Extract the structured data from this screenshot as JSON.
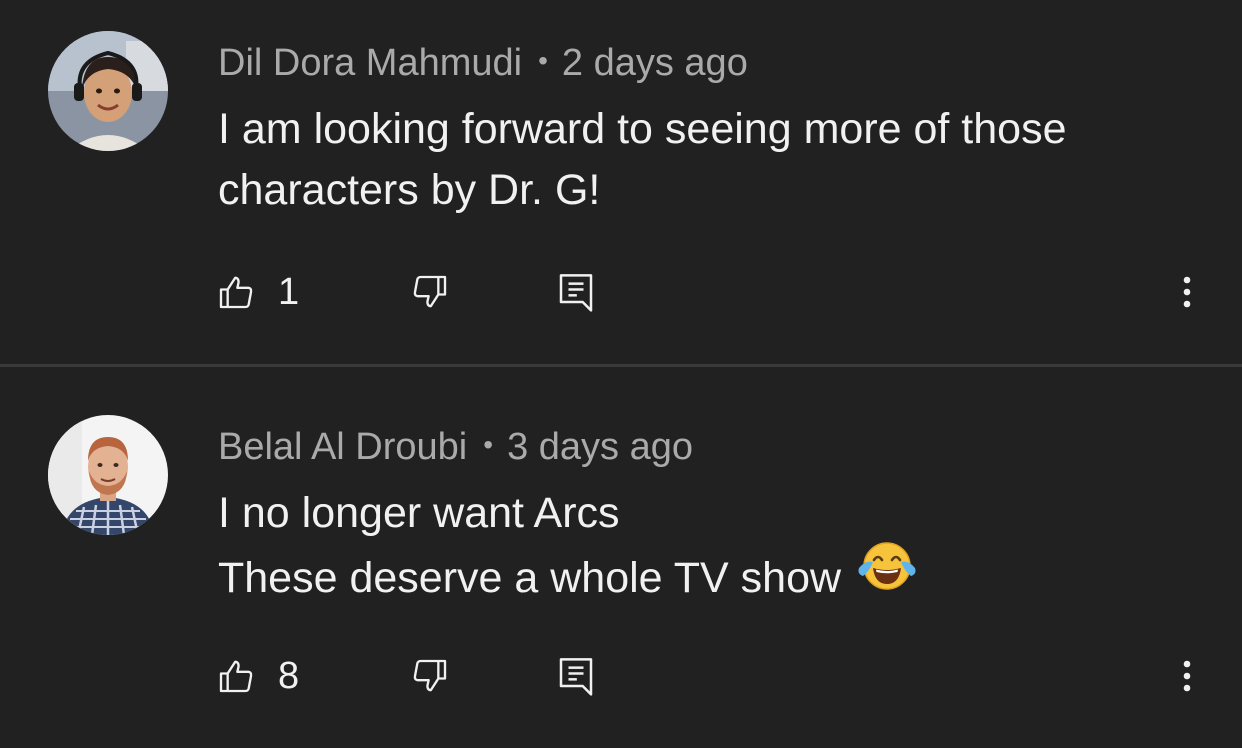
{
  "comments": [
    {
      "author": "Dil Dora Mahmudi",
      "separator": "•",
      "time": "2 days ago",
      "lines": [
        "I am looking forward to seeing more of those",
        "characters by Dr. G!"
      ],
      "likes": "1",
      "avatar_icon": "woman-with-headset-avatar",
      "emoji": null
    },
    {
      "author": "Belal Al Droubi",
      "separator": "•",
      "time": "3 days ago",
      "lines": [
        "I no longer want Arcs",
        "These deserve a whole TV show"
      ],
      "likes": "8",
      "avatar_icon": "man-with-beard-avatar",
      "emoji": "face-with-tears-of-joy"
    }
  ],
  "icons": {
    "like": "thumbs-up-icon",
    "dislike": "thumbs-down-icon",
    "reply": "reply-comment-icon",
    "more": "more-vertical-icon"
  },
  "colors": {
    "background": "#212121",
    "text": "#f1f1f1",
    "secondary_text": "#aaaaaa",
    "divider": "#3a3a3a"
  }
}
